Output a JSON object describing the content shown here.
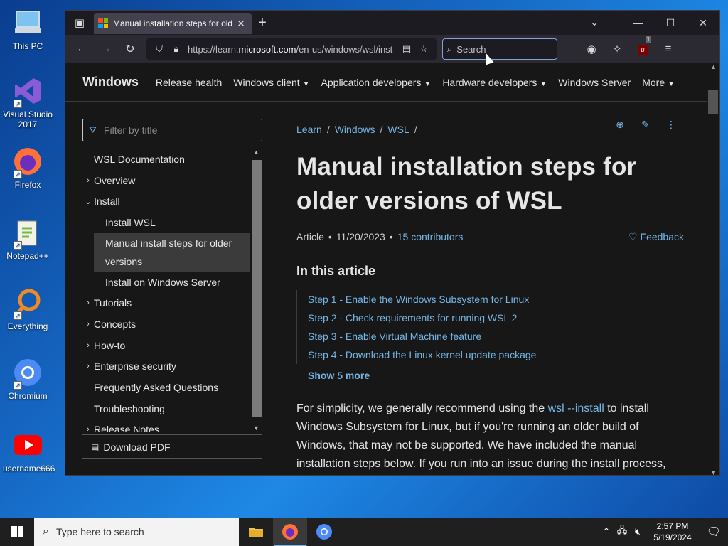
{
  "desktop": {
    "icons": [
      {
        "label": "This PC",
        "icon": "computer-icon"
      },
      {
        "label": "Visual Studio 2017",
        "icon": "visual-studio-icon"
      },
      {
        "label": "Firefox",
        "icon": "firefox-icon"
      },
      {
        "label": "Notepad++",
        "icon": "notepadpp-icon"
      },
      {
        "label": "Everything",
        "icon": "everything-icon"
      },
      {
        "label": "Chromium",
        "icon": "chromium-icon"
      },
      {
        "label": "username666",
        "icon": "youtube-icon"
      }
    ]
  },
  "browser": {
    "tab_title": "Manual installation steps for older versions of WSL",
    "tab_title_visible": "Manual installation steps for old",
    "url_prefix": "https://learn.",
    "url_domain": "microsoft.com",
    "url_path": "/en-us/windows/wsl/inst",
    "search_placeholder": "Search",
    "ublock_count": "1"
  },
  "site": {
    "brand": "Windows",
    "nav": [
      {
        "label": "Release health",
        "dropdown": false
      },
      {
        "label": "Windows client",
        "dropdown": true
      },
      {
        "label": "Application developers",
        "dropdown": true
      },
      {
        "label": "Hardware developers",
        "dropdown": true
      },
      {
        "label": "Windows Server",
        "dropdown": false
      },
      {
        "label": "More",
        "dropdown": true
      }
    ]
  },
  "sidebar": {
    "filter_placeholder": "Filter by title",
    "items": [
      {
        "label": "WSL Documentation",
        "level": 1,
        "expander": ""
      },
      {
        "label": "Overview",
        "level": 1,
        "expander": "›"
      },
      {
        "label": "Install",
        "level": 1,
        "expander": "⌄"
      },
      {
        "label": "Install WSL",
        "level": 2,
        "expander": ""
      },
      {
        "label": "Manual install steps for older versions",
        "level": 2,
        "expander": "",
        "active": true
      },
      {
        "label": "Install on Windows Server",
        "level": 2,
        "expander": ""
      },
      {
        "label": "Tutorials",
        "level": 1,
        "expander": "›"
      },
      {
        "label": "Concepts",
        "level": 1,
        "expander": "›"
      },
      {
        "label": "How-to",
        "level": 1,
        "expander": "›"
      },
      {
        "label": "Enterprise security",
        "level": 1,
        "expander": "›"
      },
      {
        "label": "Frequently Asked Questions",
        "level": 1,
        "expander": ""
      },
      {
        "label": "Troubleshooting",
        "level": 1,
        "expander": ""
      },
      {
        "label": "Release Notes",
        "level": 1,
        "expander": "›"
      }
    ],
    "download_pdf": "Download PDF"
  },
  "article": {
    "breadcrumb": [
      "Learn",
      "Windows",
      "WSL"
    ],
    "title": "Manual installation steps for older versions of WSL",
    "type": "Article",
    "date": "11/20/2023",
    "contributors": "15 contributors",
    "feedback": "Feedback",
    "in_this_article": "In this article",
    "steps": [
      "Step 1 - Enable the Windows Subsystem for Linux",
      "Step 2 - Check requirements for running WSL 2",
      "Step 3 - Enable Virtual Machine feature",
      "Step 4 - Download the Linux kernel update package"
    ],
    "show_more": "Show 5 more",
    "body_pre": "For simplicity, we generally recommend using the ",
    "body_link": "wsl --install",
    "body_post": " to install Windows Subsystem for Linux, but if you're running an older build of Windows, that may not be supported. We have included the manual installation steps below. If you run into an issue during the install process,"
  },
  "taskbar": {
    "search_placeholder": "Type here to search",
    "time": "2:57 PM",
    "date": "5/19/2024"
  },
  "colors": {
    "link": "#75b6e7",
    "page_bg": "#171717",
    "browser_bg": "#1c1b22"
  }
}
